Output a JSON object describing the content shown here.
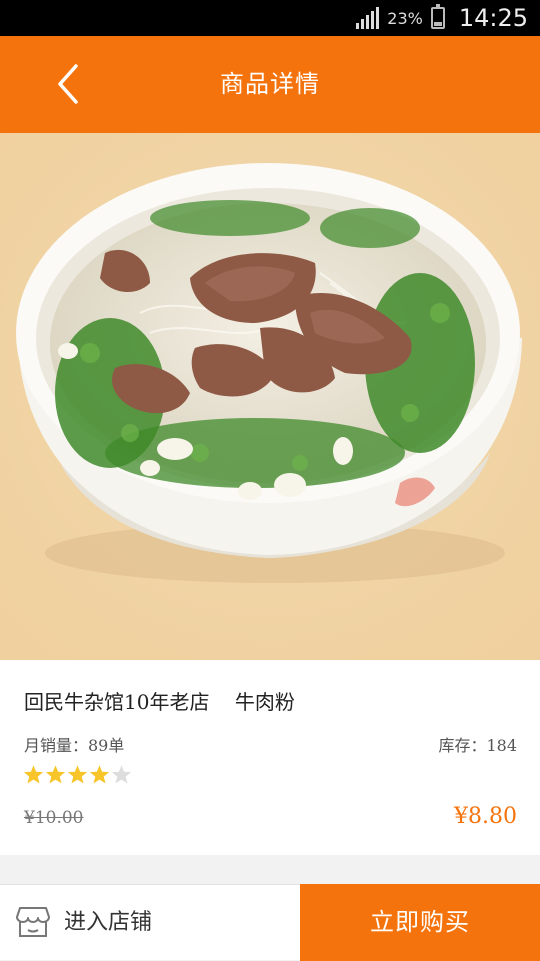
{
  "status_bar": {
    "battery_percent": "23%",
    "time": "14:25"
  },
  "header": {
    "title": "商品详情",
    "back_icon": "chevron-left-icon"
  },
  "product": {
    "name": "回民牛杂馆10年老店    牛肉粉",
    "monthly_sales": "月销量：89单",
    "stock": "库存：184",
    "rating": 4,
    "rating_max": 5,
    "original_price": "¥10.00",
    "price": "¥8.80",
    "image": "beef-rice-noodle-soup-bowl"
  },
  "bottom_bar": {
    "shop_label": "进入店铺",
    "shop_icon": "store-icon",
    "buy_label": "立即购买"
  },
  "colors": {
    "accent": "#f5730d",
    "star": "#f7c52a",
    "star_empty": "#dddddd"
  }
}
